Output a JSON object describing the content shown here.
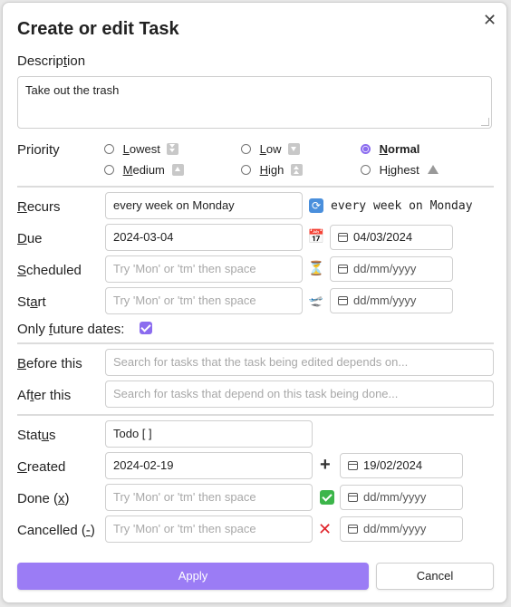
{
  "dialog": {
    "title": "Create or edit Task",
    "close_glyph": "✕"
  },
  "description": {
    "label_pre": "Descrip",
    "label_key": "t",
    "label_post": "ion",
    "value": "Take out the trash"
  },
  "priority": {
    "label": "Priority",
    "options": [
      {
        "pre": "",
        "key": "L",
        "post": "owest",
        "selected": false
      },
      {
        "pre": "",
        "key": "L",
        "post": "ow",
        "selected": false
      },
      {
        "pre": "",
        "key": "N",
        "post": "ormal",
        "selected": true
      },
      {
        "pre": "",
        "key": "M",
        "post": "edium",
        "selected": false
      },
      {
        "pre": "",
        "key": "H",
        "post": "igh",
        "selected": false
      },
      {
        "pre": "H",
        "key": "i",
        "post": "ghest",
        "selected": false
      }
    ]
  },
  "recurs": {
    "label_key": "R",
    "label_post": "ecurs",
    "value": "every week on Monday",
    "icon": "recurring-icon",
    "preview": "every week on Monday"
  },
  "due": {
    "label_key": "D",
    "label_post": "ue",
    "value": "2024-03-04",
    "icon": "calendar-icon",
    "date": "04/03/2024"
  },
  "scheduled": {
    "label_key": "S",
    "label_post": "cheduled",
    "placeholder": "Try 'Mon' or 'tm' then space",
    "icon": "hourglass-icon",
    "date_placeholder": "dd/mm/yyyy"
  },
  "start": {
    "label_pre": "St",
    "label_key": "a",
    "label_post": "rt",
    "placeholder": "Try 'Mon' or 'tm' then space",
    "icon": "airplane-departure-icon",
    "date_placeholder": "dd/mm/yyyy"
  },
  "future": {
    "label_pre": "Only ",
    "label_key": "f",
    "label_post": "uture dates:",
    "checked": true
  },
  "before": {
    "label_key": "B",
    "label_post": "efore this",
    "placeholder": "Search for tasks that the task being edited depends on..."
  },
  "after": {
    "label_pre": "Af",
    "label_key": "t",
    "label_post": "er this",
    "placeholder": "Search for tasks that depend on this task being done..."
  },
  "status": {
    "label_pre": "Stat",
    "label_key": "u",
    "label_post": "s",
    "value": "Todo [ ]"
  },
  "created": {
    "label_key": "C",
    "label_post": "reated",
    "value": "2024-02-19",
    "icon": "plus-icon",
    "date": "19/02/2024"
  },
  "done": {
    "label_pre": "Done (",
    "label_key": "x",
    "label_post": ")",
    "placeholder": "Try 'Mon' or 'tm' then space",
    "icon": "green-check-icon",
    "date_placeholder": "dd/mm/yyyy"
  },
  "cancelled": {
    "label_pre": "Cancelled (",
    "label_key": "-",
    "label_post": ")",
    "placeholder": "Try 'Mon' or 'tm' then space",
    "icon": "red-x-icon",
    "date_placeholder": "dd/mm/yyyy"
  },
  "buttons": {
    "apply": "Apply",
    "cancel": "Cancel"
  },
  "colors": {
    "accent": "#9b7cf5",
    "border": "#cfcfcf",
    "placeholder": "#a8a8a8"
  }
}
